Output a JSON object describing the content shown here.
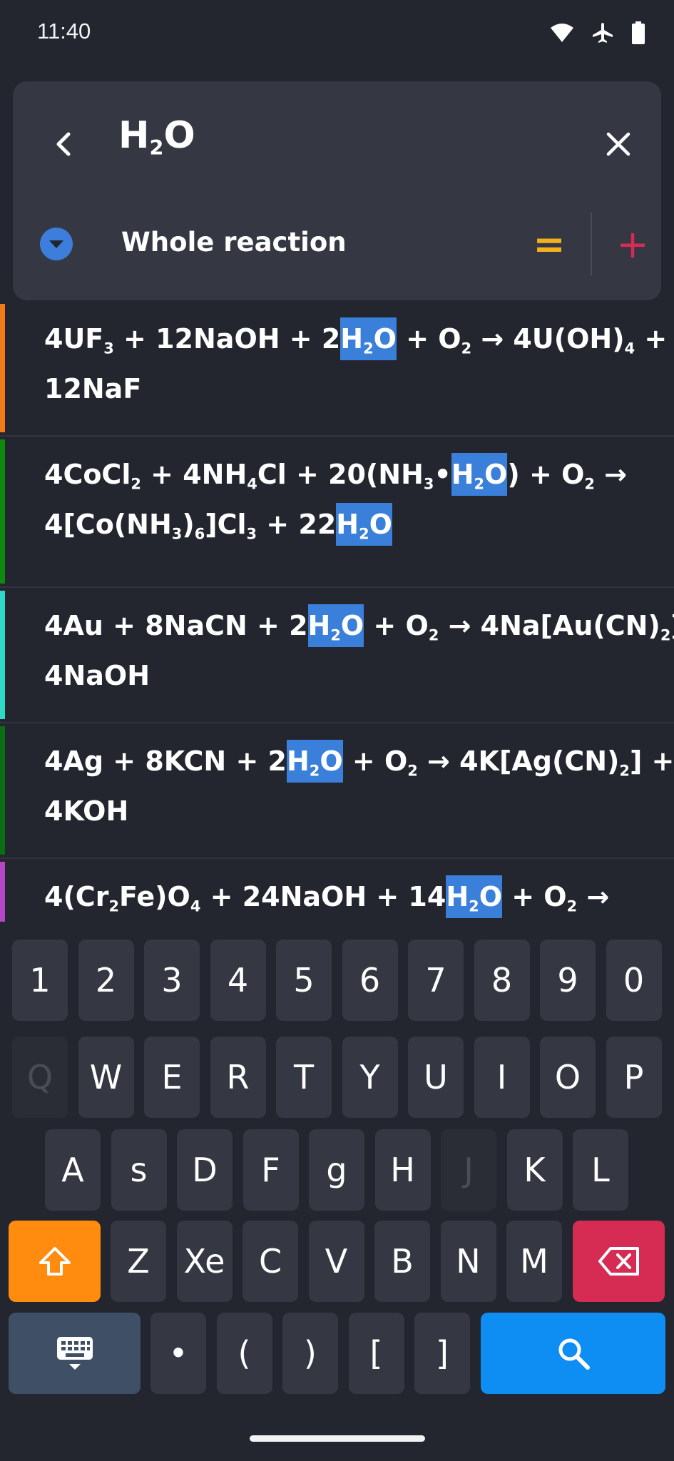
{
  "status_bar": {
    "time": "11:40",
    "icons": [
      "wifi-icon",
      "airplane-mode-icon",
      "battery-icon"
    ]
  },
  "search": {
    "query_main": "H",
    "query_sub": "2",
    "query_tail": "O",
    "filter_label": "Whole reaction",
    "equals_symbol": "=",
    "plus_symbol": "+"
  },
  "colors": {
    "accent_orange": "#ff8c0f",
    "accent_red": "#d62c53",
    "accent_blue": "#0e8df2",
    "highlight": "#3a7fd9",
    "equals": "#f2b21c"
  },
  "results": [
    {
      "accent": "#f07d1a",
      "lines": [
        [
          [
            "t",
            "4UF"
          ],
          [
            "s",
            "3"
          ],
          [
            "t",
            " + 12NaOH + 2"
          ],
          [
            "h",
            "H|2|O"
          ],
          [
            "t",
            " + O"
          ],
          [
            "s",
            "2"
          ],
          [
            "t",
            " → 4U(OH)"
          ],
          [
            "s",
            "4"
          ],
          [
            "t",
            " +"
          ]
        ],
        [
          [
            "t",
            "12NaF"
          ]
        ]
      ]
    },
    {
      "accent": "#0f8a0f",
      "lines": [
        [
          [
            "t",
            "4CoCl"
          ],
          [
            "s",
            "2"
          ],
          [
            "t",
            " + 4NH"
          ],
          [
            "s",
            "4"
          ],
          [
            "t",
            "Cl + 20(NH"
          ],
          [
            "s",
            "3"
          ],
          [
            "t",
            "•"
          ],
          [
            "h",
            "H|2|O"
          ],
          [
            "t",
            ") + O"
          ],
          [
            "s",
            "2"
          ],
          [
            "t",
            " →"
          ]
        ],
        [
          [
            "t",
            "4[Co(NH"
          ],
          [
            "s",
            "3"
          ],
          [
            "t",
            ")"
          ],
          [
            "s",
            "6"
          ],
          [
            "t",
            "]Cl"
          ],
          [
            "s",
            "3"
          ],
          [
            "t",
            " + 22"
          ],
          [
            "h",
            "H|2|O"
          ]
        ]
      ]
    },
    {
      "accent": "#2ed9c7",
      "lines": [
        [
          [
            "t",
            "4Au + 8NaCN + 2"
          ],
          [
            "h",
            "H|2|O"
          ],
          [
            "t",
            " + O"
          ],
          [
            "s",
            "2"
          ],
          [
            "t",
            " → 4Na[Au(CN)"
          ],
          [
            "s",
            "2"
          ],
          [
            "t",
            "] +"
          ]
        ],
        [
          [
            "t",
            "4NaOH"
          ]
        ]
      ]
    },
    {
      "accent": "#0a6e12",
      "lines": [
        [
          [
            "t",
            "4Ag + 8KCN + 2"
          ],
          [
            "h",
            "H|2|O"
          ],
          [
            "t",
            " + O"
          ],
          [
            "s",
            "2"
          ],
          [
            "t",
            " → 4K[Ag(CN)"
          ],
          [
            "s",
            "2"
          ],
          [
            "t",
            "] +"
          ]
        ],
        [
          [
            "t",
            "4KOH"
          ]
        ]
      ]
    },
    {
      "accent": "#b548c7",
      "lines": [
        [
          [
            "t",
            "4(Cr"
          ],
          [
            "s",
            "2"
          ],
          [
            "t",
            "Fe)O"
          ],
          [
            "s",
            "4"
          ],
          [
            "t",
            " + 24NaOH + 14"
          ],
          [
            "h",
            "H|2|O"
          ],
          [
            "t",
            " + O"
          ],
          [
            "s",
            "2"
          ],
          [
            "t",
            " →"
          ]
        ]
      ]
    }
  ],
  "keyboard": {
    "row_numbers": [
      "1",
      "2",
      "3",
      "4",
      "5",
      "6",
      "7",
      "8",
      "9",
      "0"
    ],
    "row_q": [
      "Q",
      "W",
      "E",
      "R",
      "T",
      "Y",
      "U",
      "I",
      "O",
      "P"
    ],
    "row_a": [
      "A",
      "s",
      "D",
      "F",
      "g",
      "H",
      "J",
      "K",
      "L"
    ],
    "row_z": [
      "Z",
      "Xe",
      "C",
      "V",
      "B",
      "N",
      "M"
    ],
    "row_bottom": [
      "•",
      "(",
      ")",
      "[",
      "]"
    ],
    "disabled": [
      "Q",
      "J"
    ]
  }
}
